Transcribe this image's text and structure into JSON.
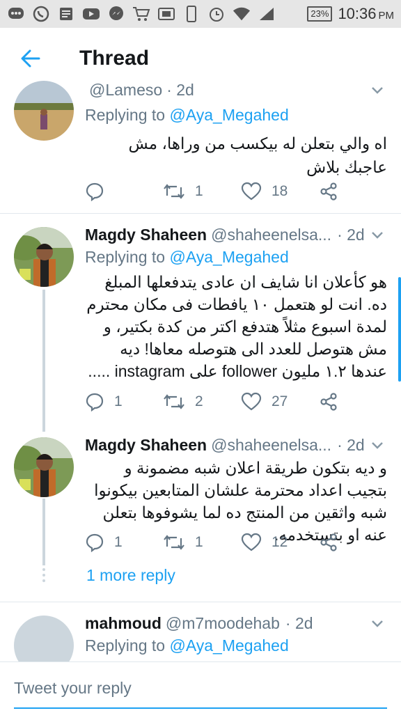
{
  "status_bar": {
    "icons": [
      "messages-icon",
      "whatsapp-icon",
      "news-icon",
      "youtube-icon",
      "messenger-icon",
      "shopping-icon",
      "sim-icon",
      "phone-icon",
      "alarm-icon",
      "wifi-icon",
      "signal-icon"
    ],
    "battery": "23%",
    "time": "10:36",
    "ampm": "PM"
  },
  "header": {
    "title": "Thread",
    "back_icon": "arrow-left-icon"
  },
  "tweets": [
    {
      "name": "",
      "handle": "@Lameso",
      "time": "· 2d",
      "replying_prefix": "Replying to ",
      "replying_to": "@Aya_Megahed",
      "text": "اه والي بتعلن له بيكسب من وراها، مش عاجبك بلاش",
      "replies": "",
      "retweets": "1",
      "likes": "18"
    },
    {
      "name": "Magdy Shaheen",
      "handle": "@shaheenelsa...",
      "time": "· 2d",
      "replying_prefix": "Replying to ",
      "replying_to": "@Aya_Megahed",
      "text": "هو كأعلان انا شايف ان عادى يتدفعلها المبلغ ده. انت لو هتعمل ١٠ يافطات فى مكان محترم لمدة اسبوع مثلاً هتدفع اكتر من كدة بكتير، و مش هتوصل للعدد الى هتوصله معاها! ديه عندها ١.٢ مليون follower على instagram .....",
      "replies": "1",
      "retweets": "2",
      "likes": "27"
    },
    {
      "name": "Magdy Shaheen",
      "handle": "@shaheenelsa...",
      "time": "· 2d",
      "text": "و ديه بتكون طريقة اعلان شبه مضمونة و بتجيب اعداد محترمة علشان المتابعين بيكونوا شبه واثقين من المنتج ده لما يشوفوها بتعلن عنه او بتستخدمه.",
      "replies": "1",
      "retweets": "1",
      "likes": "12"
    },
    {
      "name": "mahmoud",
      "handle": "@m7moodehab",
      "time": "· 2d",
      "replying_prefix": "Replying to ",
      "replying_to": "@Aya_Megahed"
    }
  ],
  "more_reply": "1 more reply",
  "reply_bar": {
    "placeholder": "Tweet your reply"
  },
  "colors": {
    "accent": "#1da1f2",
    "muted": "#657786",
    "divider": "#e1e8ed"
  }
}
